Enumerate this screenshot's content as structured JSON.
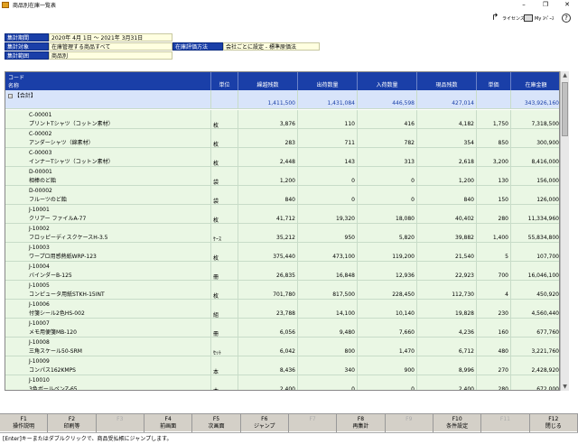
{
  "window": {
    "title": "商品別在庫一覧表",
    "controls": [
      "–",
      "❐",
      "✕"
    ]
  },
  "topbar": {
    "btn1_label": "ライセンス",
    "btn2_label": "My ｽﾍﾟｰｽ"
  },
  "conditions": {
    "period_label": "集計期間",
    "period_value": "2020年 4月 1日 〜 2021年 3月31日",
    "target_label": "集計対象",
    "target_value": "在庫管理する商品すべて",
    "eval_label": "在庫評価方法",
    "eval_value": "会社ごとに設定 - 標準原価法",
    "unit_label": "集計範囲",
    "unit_value": "商品別"
  },
  "grid": {
    "header": {
      "code": "コード",
      "name": "名称",
      "unit": "単位",
      "c1": "繰越残数",
      "c2": "出荷数量",
      "c3": "入荷数量",
      "c4": "現品残数",
      "c5": "単価",
      "c6": "在庫金額"
    },
    "total": {
      "label": "【合計】",
      "c1": "1,411,500",
      "c2": "1,431,084",
      "c3": "446,598",
      "c4": "427,014",
      "c5": "",
      "c6": "343,926,160"
    },
    "rows": [
      {
        "code": "C-00001",
        "name": "プリントTシャツ（コットン素材）",
        "unit": "枚",
        "c1": "3,876",
        "c2": "110",
        "c3": "416",
        "c4": "4,182",
        "c5": "1,750",
        "c6": "7,318,500"
      },
      {
        "code": "C-00002",
        "name": "アンダーシャツ（綿素材）",
        "unit": "枚",
        "c1": "283",
        "c2": "711",
        "c3": "782",
        "c4": "354",
        "c5": "850",
        "c6": "300,900"
      },
      {
        "code": "C-00003",
        "name": "インナーTシャツ（コットン素材）",
        "unit": "枚",
        "c1": "2,448",
        "c2": "143",
        "c3": "313",
        "c4": "2,618",
        "c5": "3,200",
        "c6": "8,416,000"
      },
      {
        "code": "D-00001",
        "name": "相棒のど飴",
        "unit": "袋",
        "c1": "1,200",
        "c2": "0",
        "c3": "0",
        "c4": "1,200",
        "c5": "130",
        "c6": "156,000"
      },
      {
        "code": "D-00002",
        "name": "フルーツのど飴",
        "unit": "袋",
        "c1": "840",
        "c2": "0",
        "c3": "0",
        "c4": "840",
        "c5": "150",
        "c6": "126,000"
      },
      {
        "code": "J-10001",
        "name": "クリアー ファイルA-77",
        "unit": "枚",
        "c1": "41,712",
        "c2": "19,320",
        "c3": "18,080",
        "c4": "40,402",
        "c5": "280",
        "c6": "11,334,960"
      },
      {
        "code": "J-10002",
        "name": "フロッピーディスクケースH-3.5",
        "unit": "ｹｰｽ",
        "c1": "35,212",
        "c2": "950",
        "c3": "5,820",
        "c4": "39,882",
        "c5": "1,400",
        "c6": "55,834,800"
      },
      {
        "code": "J-10003",
        "name": "ワープロ用感熱紙WRP-123",
        "unit": "枚",
        "c1": "375,440",
        "c2": "473,100",
        "c3": "119,200",
        "c4": "21,540",
        "c5": "5",
        "c6": "107,700"
      },
      {
        "code": "J-10004",
        "name": "バインダーB-125",
        "unit": "冊",
        "c1": "26,835",
        "c2": "16,848",
        "c3": "12,936",
        "c4": "22,923",
        "c5": "700",
        "c6": "16,046,100"
      },
      {
        "code": "J-10005",
        "name": "コンピュータ用紙STKH-15INT",
        "unit": "枚",
        "c1": "701,780",
        "c2": "817,500",
        "c3": "228,450",
        "c4": "112,730",
        "c5": "4",
        "c6": "450,920"
      },
      {
        "code": "J-10006",
        "name": "付箋シール2色HS-002",
        "unit": "組",
        "c1": "23,788",
        "c2": "14,100",
        "c3": "10,140",
        "c4": "19,828",
        "c5": "230",
        "c6": "4,560,440"
      },
      {
        "code": "J-10007",
        "name": "メモ用便箋MB-120",
        "unit": "冊",
        "c1": "6,056",
        "c2": "9,480",
        "c3": "7,660",
        "c4": "4,236",
        "c5": "160",
        "c6": "677,760"
      },
      {
        "code": "J-10008",
        "name": "三角スケール50-SRM",
        "unit": "ｾｯﾄ",
        "c1": "6,042",
        "c2": "800",
        "c3": "1,470",
        "c4": "6,712",
        "c5": "480",
        "c6": "3,221,760"
      },
      {
        "code": "J-10009",
        "name": "コンパス162KMPS",
        "unit": "本",
        "c1": "8,436",
        "c2": "340",
        "c3": "900",
        "c4": "8,996",
        "c5": "270",
        "c6": "2,428,920"
      },
      {
        "code": "J-10010",
        "name": "3色ボールペンZ-65",
        "unit": "本",
        "c1": "2,400",
        "c2": "0",
        "c3": "0",
        "c4": "2,400",
        "c5": "280",
        "c6": "672,000"
      }
    ]
  },
  "fkeys": [
    {
      "key": "F1",
      "label": "操作説明",
      "enabled": true
    },
    {
      "key": "F2",
      "label": "印刷等",
      "enabled": true
    },
    {
      "key": "F3",
      "label": "",
      "enabled": false
    },
    {
      "key": "F4",
      "label": "前画面",
      "enabled": true
    },
    {
      "key": "F5",
      "label": "次画面",
      "enabled": true
    },
    {
      "key": "F6",
      "label": "ジャンプ",
      "enabled": true
    },
    {
      "key": "F7",
      "label": "",
      "enabled": false
    },
    {
      "key": "F8",
      "label": "再集計",
      "enabled": true
    },
    {
      "key": "F9",
      "label": "",
      "enabled": false
    },
    {
      "key": "F10",
      "label": "条件設定",
      "enabled": true
    },
    {
      "key": "F11",
      "label": "",
      "enabled": false
    },
    {
      "key": "F12",
      "label": "閉じる",
      "enabled": true
    }
  ],
  "status": {
    "text": "[Enter]キーまたはダブルクリックで、商品受払帳にジャンプします。"
  }
}
